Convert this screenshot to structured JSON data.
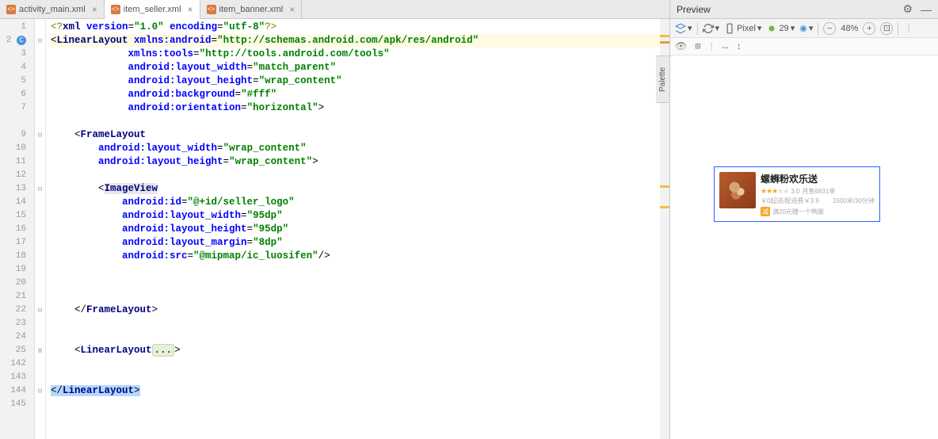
{
  "tabs": [
    {
      "label": "activity_main.xml",
      "active": false
    },
    {
      "label": "item_seller.xml",
      "active": true
    },
    {
      "label": "item_banner.xml",
      "active": false
    }
  ],
  "gutter_lines": [
    "1",
    "2",
    "3",
    "4",
    "5",
    "6",
    "7",
    "",
    "9",
    "10",
    "11",
    "12",
    "13",
    "14",
    "15",
    "16",
    "17",
    "18",
    "19",
    "20",
    "21",
    "22",
    "23",
    "24",
    "25",
    "142",
    "143",
    "144",
    "145"
  ],
  "code": {
    "l1_pi": "<?",
    "l1_kw": "xml",
    "l1_a1": "version",
    "l1_v1": "\"1.0\"",
    "l1_a2": "encoding",
    "l1_v2": "\"utf-8\"",
    "l1_pie": "?>",
    "l2_tag": "LinearLayout",
    "l2_a": "xmlns:android",
    "l2_v": "\"http://schemas.android.com/apk/res/android\"",
    "l3_a": "xmlns:tools",
    "l3_v": "\"http://tools.android.com/tools\"",
    "l4_a": "android:layout_width",
    "l4_v": "\"match_parent\"",
    "l5_a": "android:layout_height",
    "l5_v": "\"wrap_content\"",
    "l6_a": "android:background",
    "l6_v": "\"#fff\"",
    "l7_a": "android:orientation",
    "l7_v": "\"horizontal\"",
    "l9_tag": "FrameLayout",
    "l10_a": "android:layout_width",
    "l10_v": "\"wrap_content\"",
    "l11_a": "android:layout_height",
    "l11_v": "\"wrap_content\"",
    "l13_tag": "ImageView",
    "l14_a": "android:id",
    "l14_v": "\"@+id/seller_logo\"",
    "l15_a": "android:layout_width",
    "l15_v": "\"95dp\"",
    "l16_a": "android:layout_height",
    "l16_v": "\"95dp\"",
    "l17_a": "android:layout_margin",
    "l17_v": "\"8dp\"",
    "l18_a": "android:src",
    "l18_v": "\"@mipmap/ic_luosifen\"",
    "l22_close": "FrameLayout",
    "l25_tag": "LinearLayout",
    "l25_fold": "...",
    "l144_close": "LinearLayout"
  },
  "preview": {
    "title": "Preview",
    "device": "Pixel",
    "api": "29",
    "zoom": "48%",
    "palette": "Palette",
    "card": {
      "title": "螺蛳粉欢乐送",
      "rating": "3.0",
      "sales": "月售6831单",
      "price": "￥0起送/配送费￥3.9",
      "distance": "1500米/30分钟",
      "promo": "满20元赠一个鸭脚"
    }
  }
}
